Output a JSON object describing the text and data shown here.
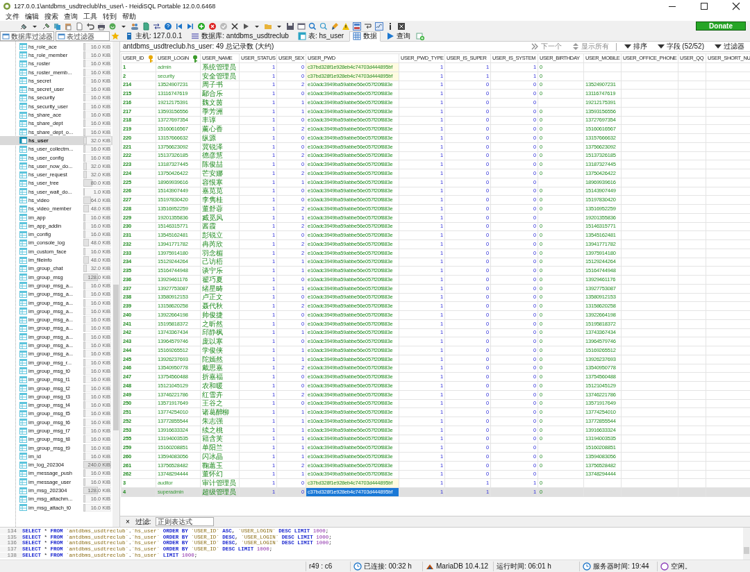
{
  "window": {
    "title": "127.0.0.1\\antdbms_usdtreclub\\hs_user\\ - HeidiSQL Portable 12.0.0.6468"
  },
  "menu": [
    "文件",
    "编辑",
    "搜索",
    "查询",
    "工具",
    "转到",
    "帮助"
  ],
  "donate": "Donate",
  "filters": [
    {
      "placeholder": "数据库过滤器"
    },
    {
      "placeholder": "表过滤器"
    }
  ],
  "tabs": [
    {
      "label": "主机: 127.0.0.1",
      "selected": false
    },
    {
      "label": "数据库: antdbms_usdtreclub",
      "selected": false
    },
    {
      "label": "表: hs_user",
      "selected": false
    },
    {
      "label": "数据",
      "selected": true
    },
    {
      "label": "查询",
      "selected": false
    }
  ],
  "sidebar": {
    "items": [
      {
        "name": "hs_role_ace",
        "size": "16.0 KiB",
        "level": 0.07,
        "selected": false
      },
      {
        "name": "hs_role_member",
        "size": "16.0 KiB",
        "level": 0.07,
        "selected": false
      },
      {
        "name": "hs_roster",
        "size": "16.0 KiB",
        "level": 0.07,
        "selected": false
      },
      {
        "name": "hs_roster_memb...",
        "size": "16.0 KiB",
        "level": 0.07,
        "selected": false
      },
      {
        "name": "hs_secret",
        "size": "16.0 KiB",
        "level": 0.07,
        "selected": false
      },
      {
        "name": "hs_secret_user",
        "size": "16.0 KiB",
        "level": 0.07,
        "selected": false
      },
      {
        "name": "hs_security",
        "size": "16.0 KiB",
        "level": 0.07,
        "selected": false
      },
      {
        "name": "hs_security_user",
        "size": "16.0 KiB",
        "level": 0.07,
        "selected": false
      },
      {
        "name": "hs_share_ace",
        "size": "16.0 KiB",
        "level": 0.07,
        "selected": false
      },
      {
        "name": "hs_share_dept",
        "size": "16.0 KiB",
        "level": 0.07,
        "selected": false
      },
      {
        "name": "hs_share_dept_o...",
        "size": "16.0 KiB",
        "level": 0.07,
        "selected": false
      },
      {
        "name": "hs_user",
        "size": "32.0 KiB",
        "level": 0.13,
        "selected": true
      },
      {
        "name": "hs_user_collectm...",
        "size": "16.0 KiB",
        "level": 0.07,
        "selected": false
      },
      {
        "name": "hs_user_config",
        "size": "16.0 KiB",
        "level": 0.07,
        "selected": false
      },
      {
        "name": "hs_user_now_do...",
        "size": "32.0 KiB",
        "level": 0.13,
        "selected": false
      },
      {
        "name": "hs_user_request",
        "size": "32.0 KiB",
        "level": 0.13,
        "selected": false
      },
      {
        "name": "hs_user_tree",
        "size": "80.0 KiB",
        "level": 0.33,
        "selected": false
      },
      {
        "name": "hs_user_wait_do...",
        "size": "1.0 KiB",
        "level": 0.01,
        "selected": false
      },
      {
        "name": "hs_video",
        "size": "64.0 KiB",
        "level": 0.27,
        "selected": false
      },
      {
        "name": "hs_video_member",
        "size": "48.0 KiB",
        "level": 0.2,
        "selected": false
      },
      {
        "name": "im_app",
        "size": "16.0 KiB",
        "level": 0.07,
        "selected": false
      },
      {
        "name": "im_app_addin",
        "size": "16.0 KiB",
        "level": 0.07,
        "selected": false
      },
      {
        "name": "im_config",
        "size": "16.0 KiB",
        "level": 0.07,
        "selected": false
      },
      {
        "name": "im_console_log",
        "size": "48.0 KiB",
        "level": 0.2,
        "selected": false
      },
      {
        "name": "im_custom_face",
        "size": "16.0 KiB",
        "level": 0.07,
        "selected": false
      },
      {
        "name": "im_fileinfo",
        "size": "48.0 KiB",
        "level": 0.2,
        "selected": false
      },
      {
        "name": "im_group_chat",
        "size": "32.0 KiB",
        "level": 0.13,
        "selected": false
      },
      {
        "name": "im_group_msg",
        "size": "128.0 KiB",
        "level": 0.53,
        "selected": false
      },
      {
        "name": "im_group_msg_a...",
        "size": "16.0 KiB",
        "level": 0.07,
        "selected": false
      },
      {
        "name": "im_group_msg_a...",
        "size": "16.0 KiB",
        "level": 0.07,
        "selected": false
      },
      {
        "name": "im_group_msg_a...",
        "size": "16.0 KiB",
        "level": 0.07,
        "selected": false
      },
      {
        "name": "im_group_msg_a...",
        "size": "16.0 KiB",
        "level": 0.07,
        "selected": false
      },
      {
        "name": "im_group_msg_a...",
        "size": "16.0 KiB",
        "level": 0.07,
        "selected": false
      },
      {
        "name": "im_group_msg_a...",
        "size": "16.0 KiB",
        "level": 0.07,
        "selected": false
      },
      {
        "name": "im_group_msg_a...",
        "size": "16.0 KiB",
        "level": 0.07,
        "selected": false
      },
      {
        "name": "im_group_msg_a...",
        "size": "16.0 KiB",
        "level": 0.07,
        "selected": false
      },
      {
        "name": "im_group_msg_a...",
        "size": "16.0 KiB",
        "level": 0.07,
        "selected": false
      },
      {
        "name": "im_group_msg_r...",
        "size": "16.0 KiB",
        "level": 0.07,
        "selected": false
      },
      {
        "name": "im_group_msg_t0",
        "size": "16.0 KiB",
        "level": 0.07,
        "selected": false
      },
      {
        "name": "im_group_msg_t1",
        "size": "16.0 KiB",
        "level": 0.07,
        "selected": false
      },
      {
        "name": "im_group_msg_t2",
        "size": "16.0 KiB",
        "level": 0.07,
        "selected": false
      },
      {
        "name": "im_group_msg_t3",
        "size": "16.0 KiB",
        "level": 0.07,
        "selected": false
      },
      {
        "name": "im_group_msg_t4",
        "size": "16.0 KiB",
        "level": 0.07,
        "selected": false
      },
      {
        "name": "im_group_msg_t5",
        "size": "16.0 KiB",
        "level": 0.07,
        "selected": false
      },
      {
        "name": "im_group_msg_t6",
        "size": "16.0 KiB",
        "level": 0.07,
        "selected": false
      },
      {
        "name": "im_group_msg_t7",
        "size": "16.0 KiB",
        "level": 0.07,
        "selected": false
      },
      {
        "name": "im_group_msg_t8",
        "size": "16.0 KiB",
        "level": 0.07,
        "selected": false
      },
      {
        "name": "im_group_msg_t9",
        "size": "16.0 KiB",
        "level": 0.07,
        "selected": false
      },
      {
        "name": "im_id",
        "size": "16.0 KiB",
        "level": 0.07,
        "selected": false
      },
      {
        "name": "im_log_202304",
        "size": "240.0 KiB",
        "level": 1,
        "selected": false
      },
      {
        "name": "im_message_push",
        "size": "16.0 KiB",
        "level": 0.07,
        "selected": false
      },
      {
        "name": "im_message_user",
        "size": "16.0 KiB",
        "level": 0.07,
        "selected": false
      },
      {
        "name": "im_msg_202304",
        "size": "128.0 KiB",
        "level": 0.53,
        "selected": false
      },
      {
        "name": "im_msg_attachm...",
        "size": "16.0 KiB",
        "level": 0.07,
        "selected": false
      },
      {
        "name": "im_msg_attach_t0",
        "size": "16.0 KiB",
        "level": 0.07,
        "selected": false
      }
    ]
  },
  "grid": {
    "caption": "antdbms_usdtreclub.hs_user: 49 总记录数 (大约)",
    "toolbar": [
      {
        "label": "下一个",
        "disabled": true
      },
      {
        "label": "显示所有",
        "disabled": true
      },
      {
        "label": "排序",
        "disabled": false
      },
      {
        "label": "字段 (52/52)",
        "disabled": false
      },
      {
        "label": "过滤器",
        "disabled": false
      }
    ],
    "columns": [
      {
        "label": "USER_ID",
        "kind": "id"
      },
      {
        "label": "USER_LOGIN",
        "kind": "text"
      },
      {
        "label": "USER_NAME",
        "kind": "name"
      },
      {
        "label": "USER_STATUS",
        "kind": "num"
      },
      {
        "label": "USER_SEX",
        "kind": "num"
      },
      {
        "label": "USER_PWD",
        "kind": "hash"
      },
      {
        "label": "USER_PWD_TYPE",
        "kind": "num"
      },
      {
        "label": "USER_IS_SUPER",
        "kind": "num"
      },
      {
        "label": "USER_IS_SYSTEM",
        "kind": "num"
      },
      {
        "label": "USER_BIRTHDAY",
        "kind": "text"
      },
      {
        "label": "USER_MOBILE",
        "kind": "text"
      },
      {
        "label": "USER_OFFICE_PHONE",
        "kind": "text"
      },
      {
        "label": "USER_QQ",
        "kind": "text"
      },
      {
        "label": "USER_SHORT_NU",
        "kind": "text"
      }
    ],
    "rows": [
      {
        "kind": "system",
        "selected": false,
        "pwd_selected": false,
        "id": "1",
        "login": "admin",
        "name": "系统管理员",
        "status": "1",
        "sex": "0",
        "pwd": "c37bd328f1e928eb4c74703d444895bf",
        "pwd_type": "1",
        "is_super": "1",
        "is_system": "1",
        "birthday": "0"
      },
      {
        "kind": "system",
        "selected": false,
        "pwd_selected": false,
        "id": "2",
        "login": "security",
        "name": "安全管理员",
        "status": "1",
        "sex": "0",
        "pwd": "c37bd328f1e928eb4c74703d444895bf",
        "pwd_type": "1",
        "is_super": "1",
        "is_system": "1",
        "birthday": "0"
      },
      {
        "kind": "user",
        "selected": false,
        "pwd_selected": false,
        "id": "214",
        "login": "13524907231",
        "name": "周子书",
        "status": "1",
        "sex": "2",
        "pwd": "e10adc3949ba59abbe56e057f20f883e",
        "pwd_type": "1",
        "is_super": "0",
        "is_system": "0",
        "birthday": "0",
        "mobile": "13524907231"
      },
      {
        "kind": "user",
        "selected": false,
        "pwd_selected": false,
        "id": "215",
        "login": "13116747619",
        "name": "鄢合乐",
        "status": "1",
        "sex": "0",
        "pwd": "e10adc3949ba59abbe56e057f20f883e",
        "pwd_type": "1",
        "is_super": "0",
        "is_system": "0",
        "birthday": "0",
        "mobile": "13116747619"
      },
      {
        "kind": "user",
        "selected": false,
        "pwd_selected": false,
        "id": "216",
        "login": "19212175391",
        "name": "魏文茵",
        "status": "1",
        "sex": "1",
        "pwd": "e10adc3949ba59abbe56e057f20f883e",
        "pwd_type": "1",
        "is_super": "0",
        "is_system": "0",
        "mobile": "19212175391"
      },
      {
        "kind": "user",
        "selected": false,
        "pwd_selected": false,
        "id": "217",
        "login": "13593156556",
        "name": "季芳洲",
        "status": "1",
        "sex": "1",
        "pwd": "e10adc3949ba59abbe56e057f20f883e",
        "pwd_type": "1",
        "is_super": "0",
        "is_system": "0",
        "birthday": "0",
        "mobile": "13593156556"
      },
      {
        "kind": "user",
        "selected": false,
        "pwd_selected": false,
        "id": "218",
        "login": "13727697354",
        "name": "丰谆",
        "status": "1",
        "sex": "0",
        "pwd": "e10adc3949ba59abbe56e057f20f883e",
        "pwd_type": "1",
        "is_super": "0",
        "is_system": "0",
        "birthday": "0",
        "mobile": "13727697354"
      },
      {
        "kind": "user",
        "selected": false,
        "pwd_selected": false,
        "id": "219",
        "login": "15160616567",
        "name": "薰心香",
        "status": "1",
        "sex": "2",
        "pwd": "e10adc3949ba59abbe56e057f20f883e",
        "pwd_type": "1",
        "is_super": "0",
        "is_system": "0",
        "birthday": "0",
        "mobile": "15160616567"
      },
      {
        "kind": "user",
        "selected": false,
        "pwd_selected": false,
        "id": "220",
        "login": "13157666632",
        "name": "纵源",
        "status": "1",
        "sex": "0",
        "pwd": "e10adc3949ba59abbe56e057f20f883e",
        "pwd_type": "1",
        "is_super": "0",
        "is_system": "0",
        "birthday": "0",
        "mobile": "13157666632"
      },
      {
        "kind": "user",
        "selected": false,
        "pwd_selected": false,
        "id": "221",
        "login": "13756623092",
        "name": "冀锐泽",
        "status": "1",
        "sex": "0",
        "pwd": "e10adc3949ba59abbe56e057f20f883e",
        "pwd_type": "1",
        "is_super": "0",
        "is_system": "0",
        "birthday": "0",
        "mobile": "13756623092"
      },
      {
        "kind": "user",
        "selected": false,
        "pwd_selected": false,
        "id": "222",
        "login": "15137326185",
        "name": "德彦慧",
        "status": "1",
        "sex": "2",
        "pwd": "e10adc3949ba59abbe56e057f20f883e",
        "pwd_type": "1",
        "is_super": "0",
        "is_system": "0",
        "birthday": "0",
        "mobile": "15137326185"
      },
      {
        "kind": "user",
        "selected": false,
        "pwd_selected": false,
        "id": "223",
        "login": "13187327445",
        "name": "陈俊喆",
        "status": "1",
        "sex": "0",
        "pwd": "e10adc3949ba59abbe56e057f20f883e",
        "pwd_type": "1",
        "is_super": "0",
        "is_system": "0",
        "birthday": "0",
        "mobile": "13187327445"
      },
      {
        "kind": "user",
        "selected": false,
        "pwd_selected": false,
        "id": "224",
        "login": "13750426422",
        "name": "芒安娜",
        "status": "1",
        "sex": "2",
        "pwd": "e10adc3949ba59abbe56e057f20f883e",
        "pwd_type": "1",
        "is_super": "0",
        "is_system": "0",
        "birthday": "0",
        "mobile": "13750426422"
      },
      {
        "kind": "user",
        "selected": false,
        "pwd_selected": false,
        "id": "225",
        "login": "18969939616",
        "name": "容恨寒",
        "status": "1",
        "sex": "1",
        "pwd": "e10adc3949ba59abbe56e057f20f883e",
        "pwd_type": "1",
        "is_super": "0",
        "is_system": "0",
        "mobile": "18969939616"
      },
      {
        "kind": "user",
        "selected": false,
        "pwd_selected": false,
        "id": "226",
        "login": "15143907449",
        "name": "嘉苋苋",
        "status": "1",
        "sex": "0",
        "pwd": "e10adc3949ba59abbe56e057f20f883e",
        "pwd_type": "1",
        "is_super": "0",
        "is_system": "0",
        "birthday": "0",
        "mobile": "15143907449"
      },
      {
        "kind": "user",
        "selected": false,
        "pwd_selected": false,
        "id": "227",
        "login": "15197830420",
        "name": "李隽桂",
        "status": "1",
        "sex": "0",
        "pwd": "e10adc3949ba59abbe56e057f20f883e",
        "pwd_type": "1",
        "is_super": "0",
        "is_system": "0",
        "birthday": "0",
        "mobile": "15197830420"
      },
      {
        "kind": "user",
        "selected": false,
        "pwd_selected": false,
        "id": "228",
        "login": "13516952259",
        "name": "董舒蓉",
        "status": "1",
        "sex": "2",
        "pwd": "e10adc3949ba59abbe56e057f20f883e",
        "pwd_type": "1",
        "is_super": "0",
        "is_system": "0",
        "birthday": "0",
        "mobile": "13516952259"
      },
      {
        "kind": "user",
        "selected": false,
        "pwd_selected": false,
        "id": "229",
        "login": "19201355836",
        "name": "臧觅风",
        "status": "1",
        "sex": "1",
        "pwd": "e10adc3949ba59abbe56e057f20f883e",
        "pwd_type": "1",
        "is_super": "0",
        "is_system": "0",
        "mobile": "19201355836"
      },
      {
        "kind": "user",
        "selected": false,
        "pwd_selected": false,
        "id": "230",
        "login": "15146315771",
        "name": "酱霞",
        "status": "1",
        "sex": "2",
        "pwd": "e10adc3949ba59abbe56e057f20f883e",
        "pwd_type": "1",
        "is_super": "0",
        "is_system": "0",
        "birthday": "0",
        "mobile": "15146315771"
      },
      {
        "kind": "user",
        "selected": false,
        "pwd_selected": false,
        "id": "231",
        "login": "13545162481",
        "name": "彭锐立",
        "status": "1",
        "sex": "0",
        "pwd": "e10adc3949ba59abbe56e057f20f883e",
        "pwd_type": "1",
        "is_super": "0",
        "is_system": "0",
        "birthday": "0",
        "mobile": "13545162481"
      },
      {
        "kind": "user",
        "selected": false,
        "pwd_selected": false,
        "id": "232",
        "login": "13941771782",
        "name": "冉芮欣",
        "status": "1",
        "sex": "2",
        "pwd": "e10adc3949ba59abbe56e057f20f883e",
        "pwd_type": "1",
        "is_super": "0",
        "is_system": "0",
        "birthday": "0",
        "mobile": "13941771782"
      },
      {
        "kind": "user",
        "selected": false,
        "pwd_selected": false,
        "id": "233",
        "login": "13975914180",
        "name": "羽念楣",
        "status": "1",
        "sex": "2",
        "pwd": "e10adc3949ba59abbe56e057f20f883e",
        "pwd_type": "1",
        "is_super": "0",
        "is_system": "0",
        "birthday": "0",
        "mobile": "13975914180"
      },
      {
        "kind": "user",
        "selected": false,
        "pwd_selected": false,
        "id": "234",
        "login": "15129244264",
        "name": "己访梧",
        "status": "1",
        "sex": "1",
        "pwd": "e10adc3949ba59abbe56e057f20f883e",
        "pwd_type": "1",
        "is_super": "0",
        "is_system": "0",
        "birthday": "0",
        "mobile": "15129244264"
      },
      {
        "kind": "user",
        "selected": false,
        "pwd_selected": false,
        "id": "235",
        "login": "15164744948",
        "name": "谈宁乐",
        "status": "1",
        "sex": "1",
        "pwd": "e10adc3949ba59abbe56e057f20f883e",
        "pwd_type": "1",
        "is_super": "0",
        "is_system": "0",
        "birthday": "0",
        "mobile": "15164744948"
      },
      {
        "kind": "user",
        "selected": false,
        "pwd_selected": false,
        "id": "236",
        "login": "13929461176",
        "name": "翟巧夏",
        "status": "1",
        "sex": "0",
        "pwd": "e10adc3949ba59abbe56e057f20f883e",
        "pwd_type": "1",
        "is_super": "0",
        "is_system": "0",
        "birthday": "0",
        "mobile": "13929461176"
      },
      {
        "kind": "user",
        "selected": false,
        "pwd_selected": false,
        "id": "237",
        "login": "13927753087",
        "name": "绪星畴",
        "status": "1",
        "sex": "1",
        "pwd": "e10adc3949ba59abbe56e057f20f883e",
        "pwd_type": "1",
        "is_super": "0",
        "is_system": "0",
        "birthday": "0",
        "mobile": "13927753087"
      },
      {
        "kind": "user",
        "selected": false,
        "pwd_selected": false,
        "id": "238",
        "login": "13580912153",
        "name": "卢正文",
        "status": "1",
        "sex": "0",
        "pwd": "e10adc3949ba59abbe56e057f20f883e",
        "pwd_type": "1",
        "is_super": "0",
        "is_system": "0",
        "birthday": "0",
        "mobile": "13580912153"
      },
      {
        "kind": "user",
        "selected": false,
        "pwd_selected": false,
        "id": "239",
        "login": "13158620258",
        "name": "聂代秋",
        "status": "1",
        "sex": "2",
        "pwd": "e10adc3949ba59abbe56e057f20f883e",
        "pwd_type": "1",
        "is_super": "0",
        "is_system": "0",
        "birthday": "0",
        "mobile": "13158620258"
      },
      {
        "kind": "user",
        "selected": false,
        "pwd_selected": false,
        "id": "240",
        "login": "13922664198",
        "name": "帅俊捷",
        "status": "1",
        "sex": "0",
        "pwd": "e10adc3949ba59abbe56e057f20f883e",
        "pwd_type": "1",
        "is_super": "0",
        "is_system": "0",
        "birthday": "0",
        "mobile": "13922664198"
      },
      {
        "kind": "user",
        "selected": false,
        "pwd_selected": false,
        "id": "241",
        "login": "15195818372",
        "name": "之昕然",
        "status": "1",
        "sex": "0",
        "pwd": "e10adc3949ba59abbe56e057f20f883e",
        "pwd_type": "1",
        "is_super": "0",
        "is_system": "0",
        "birthday": "0",
        "mobile": "15195818372"
      },
      {
        "kind": "user",
        "selected": false,
        "pwd_selected": false,
        "id": "242",
        "login": "13743367434",
        "name": "邱静枫",
        "status": "1",
        "sex": "1",
        "pwd": "e10adc3949ba59abbe56e057f20f883e",
        "pwd_type": "1",
        "is_super": "0",
        "is_system": "0",
        "birthday": "0",
        "mobile": "13743367434"
      },
      {
        "kind": "user",
        "selected": false,
        "pwd_selected": false,
        "id": "243",
        "login": "13964579746",
        "name": "庞以寒",
        "status": "1",
        "sex": "0",
        "pwd": "e10adc3949ba59abbe56e057f20f883e",
        "pwd_type": "1",
        "is_super": "0",
        "is_system": "0",
        "birthday": "0",
        "mobile": "13964579746"
      },
      {
        "kind": "user",
        "selected": false,
        "pwd_selected": false,
        "id": "244",
        "login": "15169265512",
        "name": "学俊侠",
        "status": "1",
        "sex": "1",
        "pwd": "e10adc3949ba59abbe56e057f20f883e",
        "pwd_type": "1",
        "is_super": "0",
        "is_system": "0",
        "birthday": "0",
        "mobile": "15169265512"
      },
      {
        "kind": "user",
        "selected": false,
        "pwd_selected": false,
        "id": "245",
        "login": "13926237693",
        "name": "陀嫣然",
        "status": "1",
        "sex": "1",
        "pwd": "e10adc3949ba59abbe56e057f20f883e",
        "pwd_type": "1",
        "is_super": "0",
        "is_system": "0",
        "birthday": "0",
        "mobile": "13926237693"
      },
      {
        "kind": "user",
        "selected": false,
        "pwd_selected": false,
        "id": "246",
        "login": "13540950778",
        "name": "戴思嘉",
        "status": "1",
        "sex": "2",
        "pwd": "e10adc3949ba59abbe56e057f20f883e",
        "pwd_type": "1",
        "is_super": "0",
        "is_system": "0",
        "birthday": "0",
        "mobile": "13540950778"
      },
      {
        "kind": "user",
        "selected": false,
        "pwd_selected": false,
        "id": "247",
        "login": "13754560488",
        "name": "折嘉福",
        "status": "1",
        "sex": "0",
        "pwd": "e10adc3949ba59abbe56e057f20f883e",
        "pwd_type": "1",
        "is_super": "0",
        "is_system": "0",
        "birthday": "0",
        "mobile": "13754560488"
      },
      {
        "kind": "user",
        "selected": false,
        "pwd_selected": false,
        "id": "248",
        "login": "15121045129",
        "name": "农和暖",
        "status": "1",
        "sex": "0",
        "pwd": "e10adc3949ba59abbe56e057f20f883e",
        "pwd_type": "1",
        "is_super": "0",
        "is_system": "0",
        "birthday": "0",
        "mobile": "15121045129"
      },
      {
        "kind": "user",
        "selected": false,
        "pwd_selected": false,
        "id": "249",
        "login": "13746221786",
        "name": "红雪卉",
        "status": "1",
        "sex": "2",
        "pwd": "e10adc3949ba59abbe56e057f20f883e",
        "pwd_type": "1",
        "is_super": "0",
        "is_system": "0",
        "birthday": "0",
        "mobile": "13746221786"
      },
      {
        "kind": "user",
        "selected": false,
        "pwd_selected": false,
        "id": "250",
        "login": "13571917649",
        "name": "王谷之",
        "status": "1",
        "sex": "0",
        "pwd": "e10adc3949ba59abbe56e057f20f883e",
        "pwd_type": "1",
        "is_super": "0",
        "is_system": "0",
        "birthday": "0",
        "mobile": "13571917649"
      },
      {
        "kind": "user",
        "selected": false,
        "pwd_selected": false,
        "id": "251",
        "login": "13774254010",
        "name": "诸葛醉柳",
        "status": "1",
        "sex": "1",
        "pwd": "e10adc3949ba59abbe56e057f20f883e",
        "pwd_type": "1",
        "is_super": "0",
        "is_system": "0",
        "birthday": "0",
        "mobile": "13774254010"
      },
      {
        "kind": "user",
        "selected": false,
        "pwd_selected": false,
        "id": "252",
        "login": "13772855544",
        "name": "朱志强",
        "status": "1",
        "sex": "1",
        "pwd": "e10adc3949ba59abbe56e057f20f883e",
        "pwd_type": "1",
        "is_super": "0",
        "is_system": "0",
        "birthday": "0",
        "mobile": "13772855544"
      },
      {
        "kind": "user",
        "selected": false,
        "pwd_selected": false,
        "id": "253",
        "login": "13916633324",
        "name": "续之桃",
        "status": "1",
        "sex": "1",
        "pwd": "e10adc3949ba59abbe56e057f20f883e",
        "pwd_type": "1",
        "is_super": "0",
        "is_system": "0",
        "birthday": "0",
        "mobile": "13916633324"
      },
      {
        "kind": "user",
        "selected": false,
        "pwd_selected": false,
        "id": "255",
        "login": "13194003535",
        "name": "籍含芙",
        "status": "1",
        "sex": "1",
        "pwd": "e10adc3949ba59abbe56e057f20f883e",
        "pwd_type": "1",
        "is_super": "0",
        "is_system": "0",
        "birthday": "0",
        "mobile": "13194003535"
      },
      {
        "kind": "user",
        "selected": false,
        "pwd_selected": false,
        "id": "259",
        "login": "15160208851",
        "name": "单阳兰",
        "status": "1",
        "sex": "1",
        "pwd": "e10adc3949ba59abbe56e057f20f883e",
        "pwd_type": "1",
        "is_super": "0",
        "is_system": "0",
        "mobile": "15160208851"
      },
      {
        "kind": "user",
        "selected": false,
        "pwd_selected": false,
        "id": "260",
        "login": "13594083056",
        "name": "闪冰晶",
        "status": "1",
        "sex": "1",
        "pwd": "e10adc3949ba59abbe56e057f20f883e",
        "pwd_type": "1",
        "is_super": "0",
        "is_system": "0",
        "birthday": "0",
        "mobile": "13594083056"
      },
      {
        "kind": "user",
        "selected": false,
        "pwd_selected": false,
        "id": "261",
        "login": "13756528482",
        "name": "鞠蕙玉",
        "status": "1",
        "sex": "2",
        "pwd": "e10adc3949ba59abbe56e057f20f883e",
        "pwd_type": "1",
        "is_super": "0",
        "is_system": "0",
        "birthday": "0",
        "mobile": "13756528482"
      },
      {
        "kind": "user",
        "selected": false,
        "pwd_selected": false,
        "id": "262",
        "login": "13748294444",
        "name": "董怀幻",
        "status": "1",
        "sex": "1",
        "pwd": "e10adc3949ba59abbe56e057f20f883e",
        "pwd_type": "1",
        "is_super": "0",
        "is_system": "0",
        "mobile": "13748294444"
      },
      {
        "kind": "system",
        "selected": false,
        "pwd_selected": false,
        "id": "3",
        "login": "auditor",
        "name": "审计管理员",
        "status": "1",
        "sex": "0",
        "pwd": "c37bd328f1e928eb4c74703d444895bf",
        "pwd_type": "1",
        "is_super": "1",
        "is_system": "1",
        "birthday": "0"
      },
      {
        "kind": "system",
        "selected": true,
        "pwd_selected": true,
        "id": "4",
        "login": "superadmin",
        "name": "超级管理员",
        "status": "1",
        "sex": "0",
        "pwd": "c37bd328f1e928eb4c74703d444895bf",
        "pwd_type": "1",
        "is_super": "1",
        "is_system": "1",
        "birthday": "0"
      }
    ]
  },
  "filter_bar": {
    "close": "×",
    "label": "过滤:",
    "placeholder": "正则表达式"
  },
  "query_log": [
    {
      "number": "134",
      "text": "SELECT * FROM `antdbms_usdtreclub`.`hs_user` ORDER BY `USER_ID` ASC, `USER_LOGIN` DESC LIMIT 1000;"
    },
    {
      "number": "135",
      "text": "SELECT * FROM `antdbms_usdtreclub`.`hs_user` ORDER BY `USER_ID` DESC, `USER_LOGIN` DESC LIMIT 1000;"
    },
    {
      "number": "136",
      "text": "SELECT * FROM `antdbms_usdtreclub`.`hs_user` ORDER BY `USER_ID` DESC, `USER_LOGIN` DESC LIMIT 1000;"
    },
    {
      "number": "137",
      "text": "SELECT * FROM `antdbms_usdtreclub`.`hs_user` ORDER BY `USER_ID` DESC LIMIT 1000;"
    },
    {
      "number": "138",
      "text": "SELECT * FROM `antdbms_usdtreclub`.`hs_user` LIMIT 1000;"
    }
  ],
  "status_bar": [
    {
      "text": "r49 : c6"
    },
    {
      "text": "已连接: 00:32 h"
    },
    {
      "text": "MariaDB 10.4.12"
    },
    {
      "text": "运行时间: 06:01 h"
    },
    {
      "text": "服务器时间: 19:44"
    },
    {
      "text": "空闲。"
    }
  ]
}
